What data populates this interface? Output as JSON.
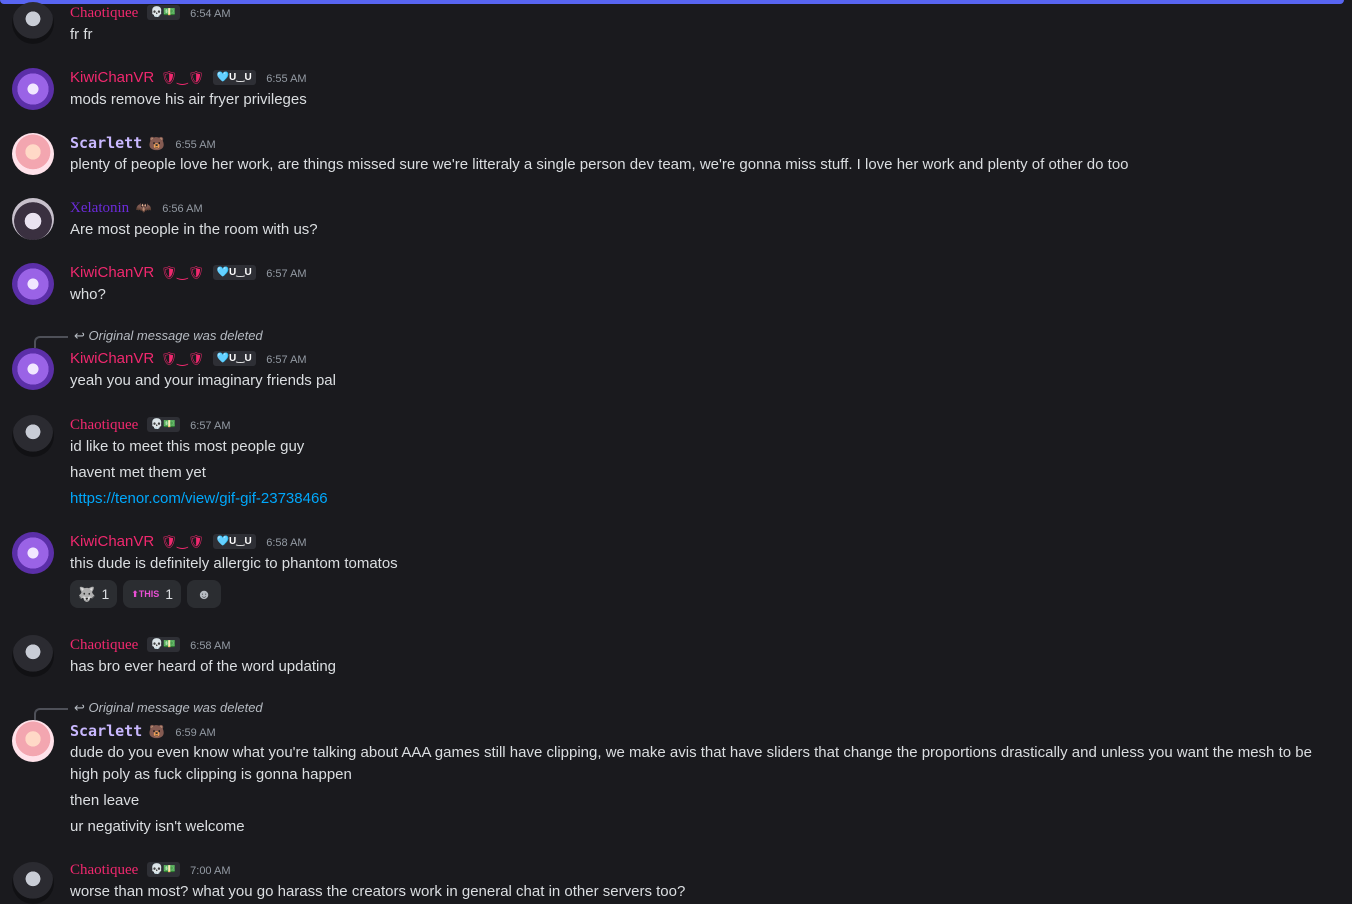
{
  "messages": [
    {
      "author": "Chaotiquee",
      "badge": "💀💵",
      "time": "6:54 AM",
      "lines": [
        "fr fr"
      ]
    },
    {
      "author": "KiwiChanVR",
      "author_deco": "🛡‿🛡",
      "badge": "🩵U‿U",
      "time": "6:55 AM",
      "lines": [
        "mods remove his air fryer privileges"
      ]
    },
    {
      "author": "Scarlett",
      "badge": "🐻",
      "time": "6:55 AM",
      "lines": [
        "plenty of people love her work, are things missed sure we're litteraly a single person dev team, we're gonna miss stuff. I love her work and plenty of other do too"
      ]
    },
    {
      "author": "Xelatonin",
      "badge": "🦇",
      "time": "6:56 AM",
      "lines": [
        "Are most people in the room with us?"
      ]
    },
    {
      "author": "KiwiChanVR",
      "author_deco": "🛡‿🛡",
      "badge": "🩵U‿U",
      "time": "6:57 AM",
      "lines": [
        "who?"
      ]
    },
    {
      "reply": "Original message was deleted",
      "author": "KiwiChanVR",
      "author_deco": "🛡‿🛡",
      "badge": "🩵U‿U",
      "time": "6:57 AM",
      "lines": [
        "yeah you and your imaginary friends pal"
      ]
    },
    {
      "author": "Chaotiquee",
      "badge": "💀💵",
      "time": "6:57 AM",
      "lines": [
        "id like to meet this most people guy",
        "havent met them yet",
        "https://tenor.com/view/gif-gif-23738466"
      ]
    },
    {
      "author": "KiwiChanVR",
      "author_deco": "🛡‿🛡",
      "badge": "🩵U‿U",
      "time": "6:58 AM",
      "lines": [
        "this dude is definitely allergic to phantom tomatos"
      ],
      "reactions": [
        {
          "emoji": "🐺",
          "count": "1"
        },
        {
          "emoji": "⬆THIS",
          "count": "1"
        }
      ]
    },
    {
      "author": "Chaotiquee",
      "badge": "💀💵",
      "time": "6:58 AM",
      "lines": [
        "has bro ever heard of the word updating"
      ]
    },
    {
      "reply": "Original message was deleted",
      "author": "Scarlett",
      "badge": "🐻",
      "time": "6:59 AM",
      "lines": [
        "dude do you even know what you're talking about AAA games still have clipping, we make avis that have sliders that change the proportions drastically and unless you want the mesh to be high poly as fuck clipping is gonna happen",
        "then leave",
        "ur negativity isn't welcome"
      ]
    },
    {
      "author": "Chaotiquee",
      "badge": "💀💵",
      "time": "7:00 AM",
      "lines": [
        "worse than most? what you go harass the creators work in general chat in other servers too?"
      ]
    }
  ],
  "add_reaction_icon": "smiley-icon",
  "colors": {
    "accent": "#5865f2",
    "background": "#1a1a1e",
    "link": "#00a8fc",
    "name_red": "#f0286e",
    "name_scarlett": "#c9b8ff",
    "name_xela": "#6b2bd9"
  }
}
